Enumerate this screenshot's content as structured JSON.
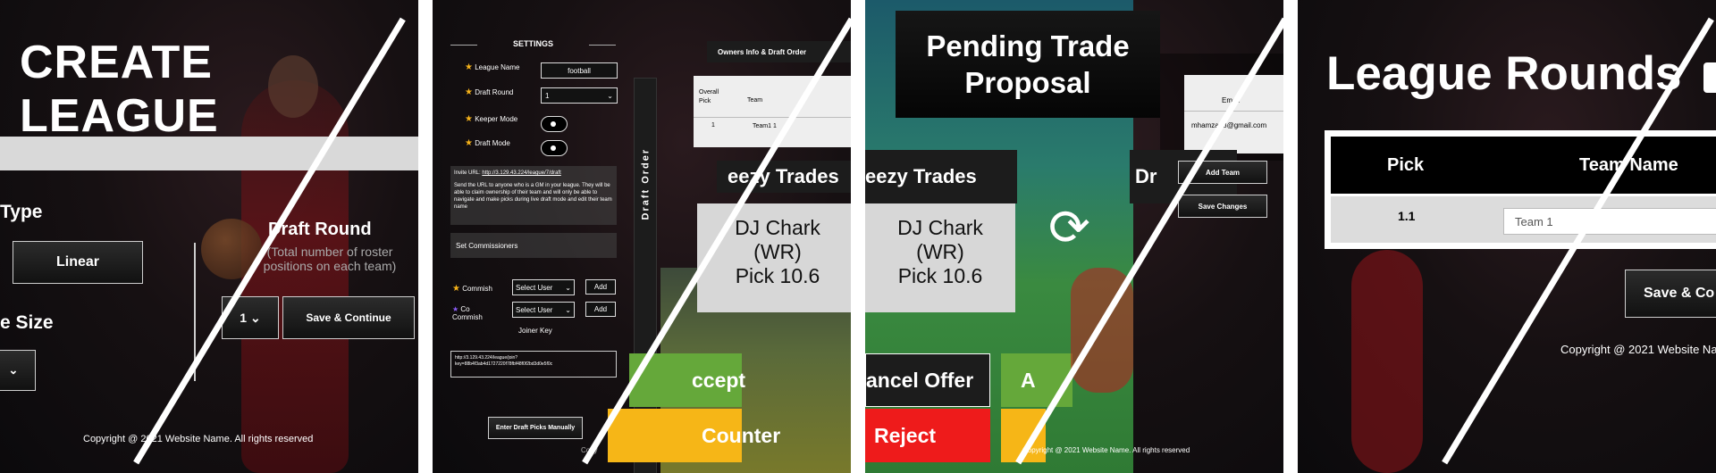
{
  "create_league": {
    "title": "CREATE LEAGUE",
    "type_label": "Type",
    "type_value": "Linear",
    "size_label": "e Size",
    "draft_round_label": "Draft Round",
    "draft_round_help": "(Total number of roster positions on each team)",
    "round_select_value": "1",
    "save_continue": "Save & Continue",
    "copyright": "Copyright @ 2021 Website Name. All rights reserved"
  },
  "settings": {
    "heading": "SETTINGS",
    "league_name_label": "League Name",
    "league_name_value": "football",
    "draft_round_label": "Draft Round",
    "draft_round_value": "1",
    "keeper_mode_label": "Keeper Mode",
    "draft_mode_label": "Draft Mode",
    "invite_url_label": "Invite URL:",
    "invite_url": "http://3.129.43.224/league/7/draft",
    "invite_text": "Send the URL to anyone who is a GM in your league. They will be able to claim ownership of their team and will only be able to navigate and make picks during live draft mode and edit their team name",
    "set_commissioners": "Set Commissioners",
    "commish_label": "Commish",
    "co_commish_label": "Co Commish",
    "select_user": "Select User",
    "add": "Add",
    "joiner_key_label": "Joiner Key",
    "joiner_key_value": "http://3.129.43.224/league/join?key=88b4f3ab4d1727220f78fbf48f0f2bd3d0e5f0c",
    "enter_picks_manually": "Enter Draft Picks Manually",
    "sidebar_label": "Draft Order",
    "owners_tab": "Owners Info & Draft Order",
    "table_headers": [
      "Overall Pick",
      "Team"
    ],
    "table_row": [
      "1",
      "Team1 1"
    ],
    "copyright_partial": "Copy"
  },
  "trades_left": {
    "title": "eezy Trades",
    "card_line1": "DJ Chark",
    "card_line2": "(WR)",
    "card_line3": "Pick 10.6",
    "accept": "ccept",
    "counter": "Counter"
  },
  "trades_right": {
    "title": "eezy Trades",
    "card_line1": "DJ Chark",
    "card_line2": "(WR)",
    "card_line3": "Pick 10.6",
    "cancel_offer": "ancel Offer",
    "reject": "Reject",
    "accept_partial": "A"
  },
  "pending": {
    "title_line1": "Pending Trade",
    "title_line2": "Proposal",
    "email_header": "Email",
    "email_value": "mhamza18@gmail.com",
    "dr_partial": "Dr",
    "add_team": "Add Team",
    "save_changes": "Save Changes",
    "copyright": "Copyright @ 2021 Website Name. All rights reserved"
  },
  "league_rounds": {
    "title": "League Rounds",
    "col_pick": "Pick",
    "col_team": "Team Name",
    "row_pick": "1.1",
    "row_team_placeholder": "Team 1",
    "save_continue": "Save & Co",
    "copyright": "Copyright @ 2021 Website Na"
  },
  "colors": {
    "accept_green": "#65a83a",
    "counter_yellow": "#f6b617",
    "reject_red": "#ee1b1b",
    "star": "#f5b21a"
  }
}
